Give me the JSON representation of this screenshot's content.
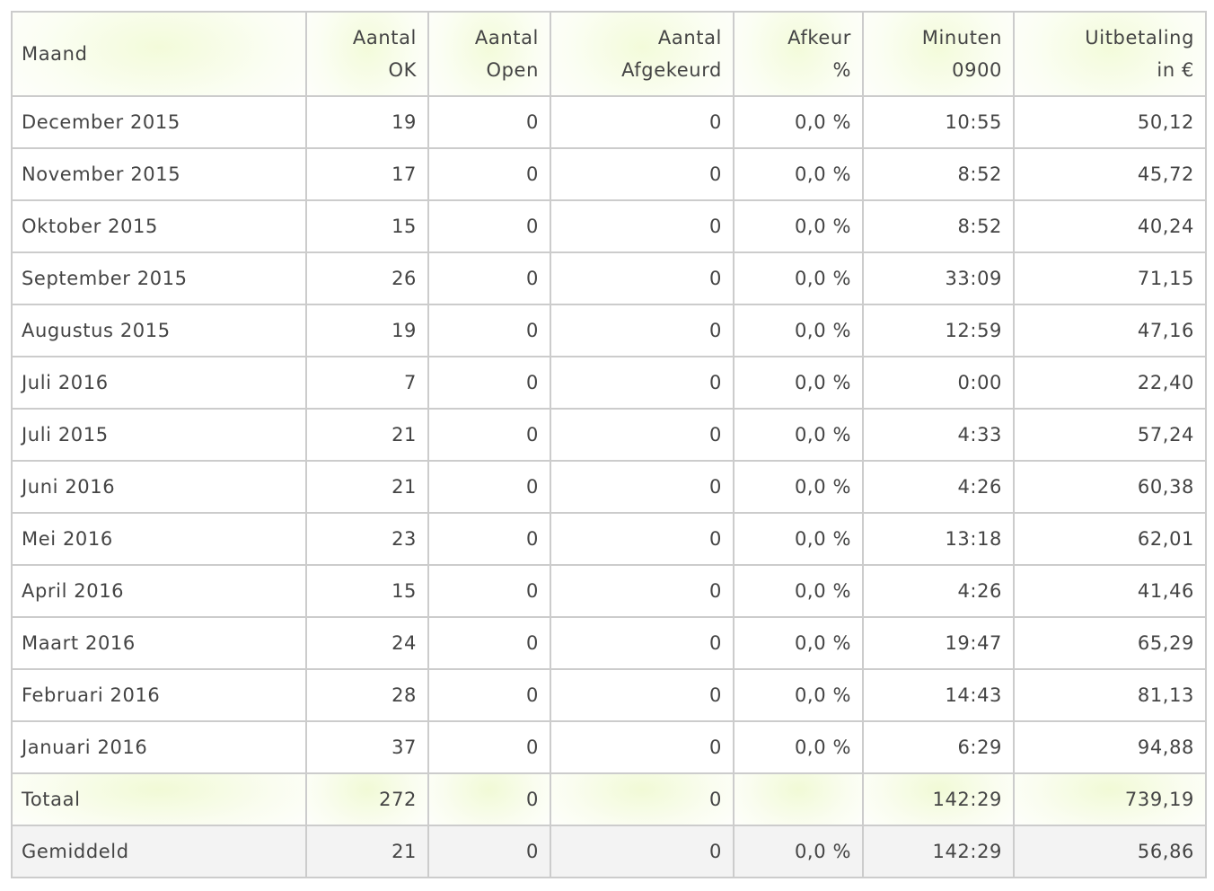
{
  "headers": [
    {
      "line1": "Maand",
      "line2": ""
    },
    {
      "line1": "Aantal",
      "line2": "OK"
    },
    {
      "line1": "Aantal",
      "line2": "Open"
    },
    {
      "line1": "Aantal",
      "line2": "Afgekeurd"
    },
    {
      "line1": "Afkeur",
      "line2": "%"
    },
    {
      "line1": "Minuten",
      "line2": "0900"
    },
    {
      "line1": "Uitbetaling",
      "line2": "in €"
    }
  ],
  "rows": [
    [
      "December 2015",
      "19",
      "0",
      "0",
      "0,0 %",
      "10:55",
      "50,12"
    ],
    [
      "November 2015",
      "17",
      "0",
      "0",
      "0,0 %",
      "8:52",
      "45,72"
    ],
    [
      "Oktober 2015",
      "15",
      "0",
      "0",
      "0,0 %",
      "8:52",
      "40,24"
    ],
    [
      "September 2015",
      "26",
      "0",
      "0",
      "0,0 %",
      "33:09",
      "71,15"
    ],
    [
      "Augustus 2015",
      "19",
      "0",
      "0",
      "0,0 %",
      "12:59",
      "47,16"
    ],
    [
      "Juli 2016",
      "7",
      "0",
      "0",
      "0,0 %",
      "0:00",
      "22,40"
    ],
    [
      "Juli 2015",
      "21",
      "0",
      "0",
      "0,0 %",
      "4:33",
      "57,24"
    ],
    [
      "Juni 2016",
      "21",
      "0",
      "0",
      "0,0 %",
      "4:26",
      "60,38"
    ],
    [
      "Mei 2016",
      "23",
      "0",
      "0",
      "0,0 %",
      "13:18",
      "62,01"
    ],
    [
      "April 2016",
      "15",
      "0",
      "0",
      "0,0 %",
      "4:26",
      "41,46"
    ],
    [
      "Maart 2016",
      "24",
      "0",
      "0",
      "0,0 %",
      "19:47",
      "65,29"
    ],
    [
      "Februari 2016",
      "28",
      "0",
      "0",
      "0,0 %",
      "14:43",
      "81,13"
    ],
    [
      "Januari 2016",
      "37",
      "0",
      "0",
      "0,0 %",
      "6:29",
      "94,88"
    ]
  ],
  "total": [
    "Totaal",
    "272",
    "0",
    "0",
    "",
    "142:29",
    "739,19"
  ],
  "average": [
    "Gemiddeld",
    "21",
    "0",
    "0",
    "0,0 %",
    "142:29",
    "56,86"
  ],
  "colors": {
    "border": "#cccccc",
    "text": "#444444",
    "header_highlight": "#f3fbda",
    "average_row_bg": "#f3f3f3"
  }
}
